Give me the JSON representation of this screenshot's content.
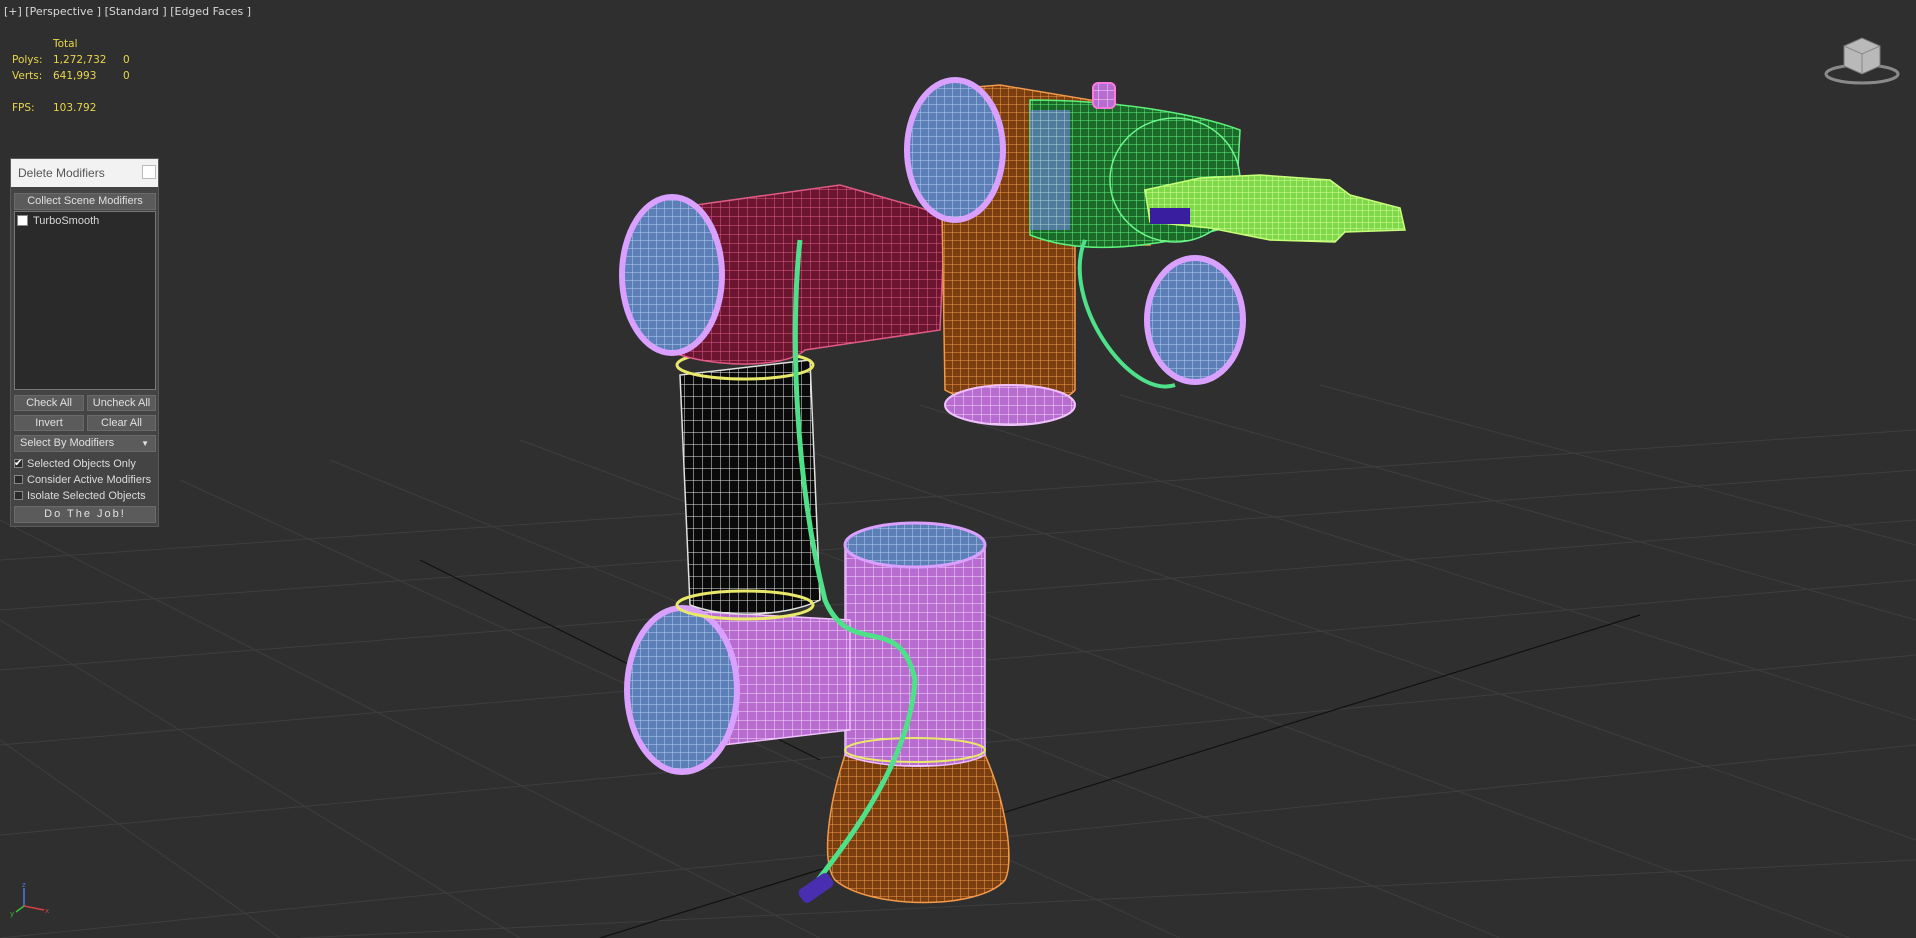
{
  "viewport": {
    "label": "[+] [Perspective ] [Standard ] [Edged Faces ]",
    "stats": {
      "header": "Total",
      "polys_label": "Polys:",
      "polys_value": "1,272,732",
      "polys_selected": "0",
      "verts_label": "Verts:",
      "verts_value": "641,993",
      "verts_selected": "0",
      "fps_label": "FPS:",
      "fps_value": "103.792"
    },
    "colors": {
      "background": "#2f2f2f",
      "grid": "#3c3c3c",
      "stats_text": "#e8d64a"
    },
    "icons": [
      "viewcube-icon",
      "axis-tripod-icon"
    ]
  },
  "delete_modifiers_panel": {
    "title": "Delete Modifiers",
    "collect_button": "Collect Scene Modifiers",
    "modifier_list": [
      {
        "label": "TurboSmooth",
        "checked": false
      }
    ],
    "check_all": "Check All",
    "uncheck_all": "Uncheck All",
    "invert": "Invert",
    "clear_all": "Clear All",
    "select_by": "Select By Modifiers",
    "options": [
      {
        "label": "Selected Objects Only",
        "checked": true
      },
      {
        "label": "Consider Active Modifiers",
        "checked": false
      },
      {
        "label": "Isolate Selected Objects",
        "checked": false
      }
    ],
    "do_job": "Do The Job!"
  }
}
